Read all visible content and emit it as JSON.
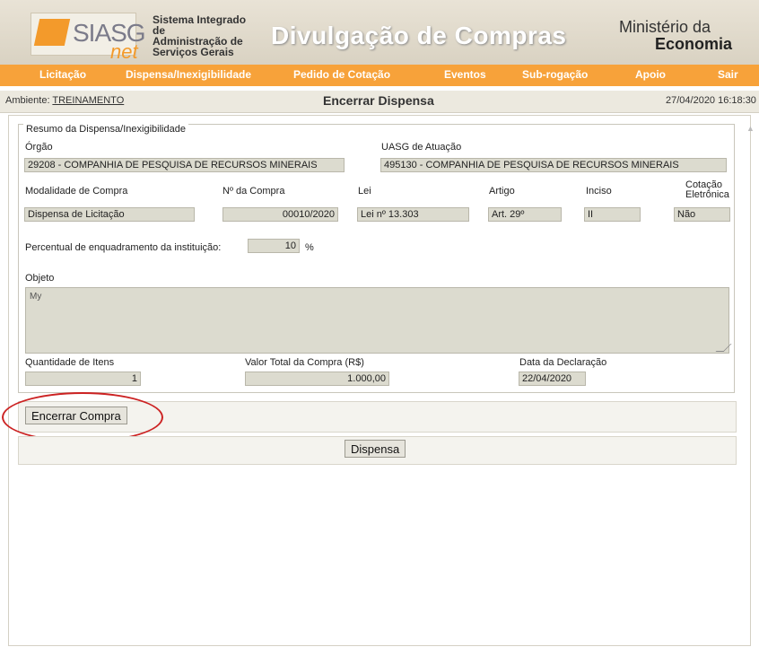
{
  "header": {
    "logo_siasg": "SIASG",
    "logo_net": "net",
    "system_line1": "Sistema Integrado de",
    "system_line2": "Administração de",
    "system_line3": "Serviços Gerais",
    "banner": "Divulgação de Compras",
    "ministry_line1": "Ministério da",
    "ministry_line2": "Economia"
  },
  "nav": {
    "items": [
      "Licitação",
      "Dispensa/Inexigibilidade",
      "Pedido de Cotação",
      "Eventos",
      "Sub-rogação",
      "Apoio",
      "Sair"
    ]
  },
  "info": {
    "env_label": "Ambiente:",
    "env_value": "TREINAMENTO",
    "page_title": "Encerrar Dispensa",
    "datetime": "27/04/2020 16:18:30"
  },
  "resumo": {
    "legend": "Resumo da Dispensa/Inexigibilidade",
    "orgao_label": "Órgão",
    "orgao_value": "29208 - COMPANHIA DE PESQUISA DE RECURSOS MINERAIS",
    "uasg_label": "UASG de Atuação",
    "uasg_value": "495130 - COMPANHIA DE PESQUISA DE RECURSOS MINERAIS",
    "modalidade_label": "Modalidade de Compra",
    "modalidade_value": "Dispensa de Licitação",
    "numero_label": "Nº da Compra",
    "numero_value": "00010/2020",
    "lei_label": "Lei",
    "lei_value": "Lei nº 13.303",
    "artigo_label": "Artigo",
    "artigo_value": "Art. 29º",
    "inciso_label": "Inciso",
    "inciso_value": "II",
    "cotacao_label1": "Cotação",
    "cotacao_label2": "Eletrônica",
    "cotacao_value": "Não",
    "percentual_label": "Percentual de enquadramento da instituição:",
    "percentual_value": "10",
    "percentual_unit": "%",
    "objeto_label": "Objeto",
    "objeto_value": "My",
    "qtd_label": "Quantidade de Itens",
    "qtd_value": "1",
    "valor_label": "Valor Total da Compra (R$)",
    "valor_value": "1.000,00",
    "data_label": "Data da Declaração",
    "data_value": "22/04/2020"
  },
  "actions": {
    "encerrar_button": "Encerrar Compra",
    "dispensa_button": "Dispensa"
  },
  "colors": {
    "nav_orange": "#f7a23a",
    "field_bg": "#dcdbcf",
    "highlight_circle": "#cc2222"
  }
}
